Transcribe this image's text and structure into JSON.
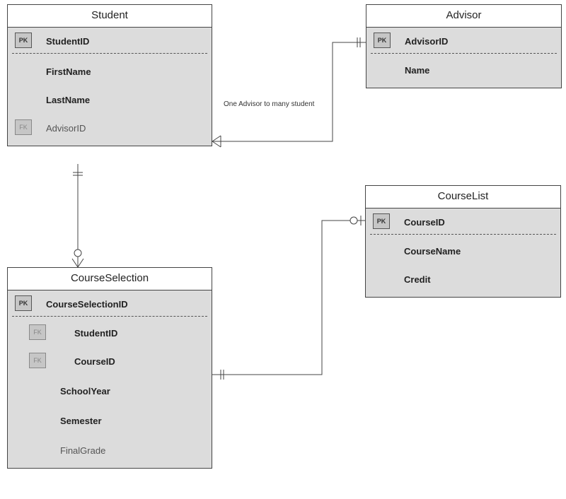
{
  "entities": {
    "student": {
      "title": "Student",
      "pk": "StudentID",
      "attrs": [
        "FirstName",
        "LastName"
      ],
      "fk": "AdvisorID"
    },
    "advisor": {
      "title": "Advisor",
      "pk": "AdvisorID",
      "attrs": [
        "Name"
      ]
    },
    "courseList": {
      "title": "CourseList",
      "pk": "CourseID",
      "attrs": [
        "CourseName",
        "Credit"
      ]
    },
    "courseSelection": {
      "title": "CourseSelection",
      "pk": "CourseSelectionID",
      "fk1": "StudentID",
      "fk2": "CourseID",
      "attrs": [
        "SchoolYear",
        "Semester"
      ],
      "optional": "FinalGrade"
    }
  },
  "labels": {
    "relationship1": "One Advisor to many student",
    "pkBadge": "PK",
    "fkBadge": "FK"
  }
}
